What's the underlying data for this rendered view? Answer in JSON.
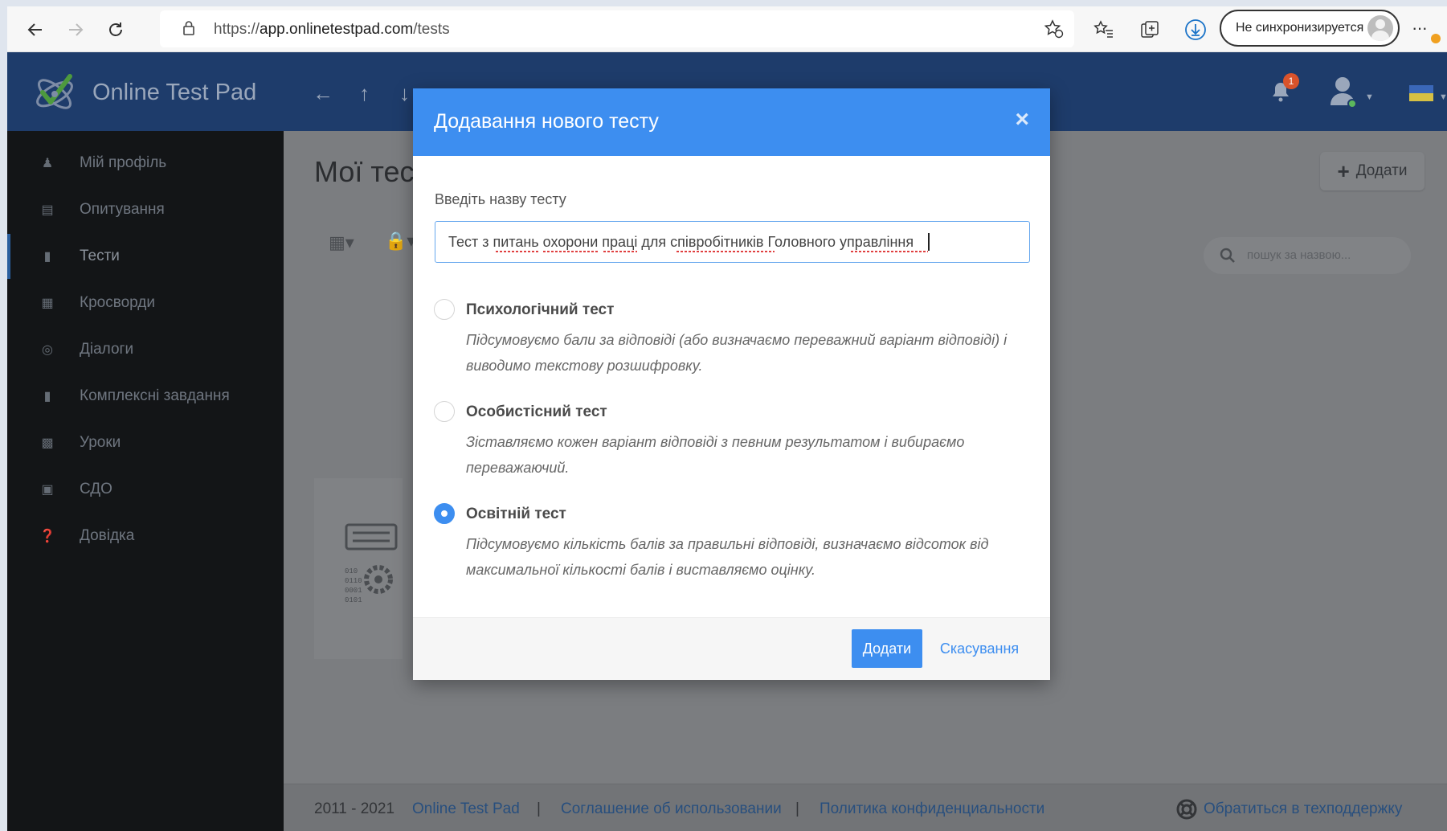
{
  "browser": {
    "url_scheme": "https://",
    "url_host": "app.onlinetestpad.com",
    "url_path": "/tests",
    "sync_label": "Не синхронизируется",
    "more_label": "···"
  },
  "header": {
    "brand": "Online Test Pad",
    "notification_count": "1",
    "accent_color": "#1e3c6b"
  },
  "sidebar": {
    "items": [
      {
        "label": "Мій профіль",
        "icon": "user-icon"
      },
      {
        "label": "Опитування",
        "icon": "survey-icon"
      },
      {
        "label": "Тести",
        "icon": "test-icon",
        "active": true
      },
      {
        "label": "Кросворди",
        "icon": "crossword-icon"
      },
      {
        "label": "Діалоги",
        "icon": "dialog-icon"
      },
      {
        "label": "Комплексні завдання",
        "icon": "complex-task-icon"
      },
      {
        "label": "Уроки",
        "icon": "lesson-icon"
      },
      {
        "label": "СДО",
        "icon": "lms-icon"
      },
      {
        "label": "Довідка",
        "icon": "help-icon"
      }
    ]
  },
  "main": {
    "page_title": "Мої тести",
    "add_label": "Додати",
    "search_placeholder": "пошук за назвою..."
  },
  "footer": {
    "copyright": "2011 - 2021",
    "link_brand": "Online Test Pad",
    "separator": "|",
    "link_terms": "Соглашение об использовании",
    "link_privacy": "Политика конфиденциальности",
    "support": "Обратиться в техподдержку"
  },
  "modal": {
    "title": "Додавання нового тесту",
    "close_symbol": "×",
    "field_label": "Введіть назву тесту",
    "field_value": "Тест з питань охорони праці для співробітників Головного управління",
    "primary_color": "#3d8ef0",
    "options": [
      {
        "title": "Психологічний тест",
        "description": "Підсумовуємо бали за відповіді (або визначаємо переважний варіант відповіді) і виводимо текстову розшифровку.",
        "checked": false
      },
      {
        "title": "Особистісний тест",
        "description": "Зіставляємо кожен варіант відповіді з певним результатом і вибираємо переважаючий.",
        "checked": false
      },
      {
        "title": "Освітній тест",
        "description": "Підсумовуємо кількість балів за правильні відповіді, визначаємо відсоток від максимальної кількості балів і виставляємо оцінку.",
        "checked": true
      }
    ],
    "submit_label": "Додати",
    "cancel_label": "Скасування"
  }
}
